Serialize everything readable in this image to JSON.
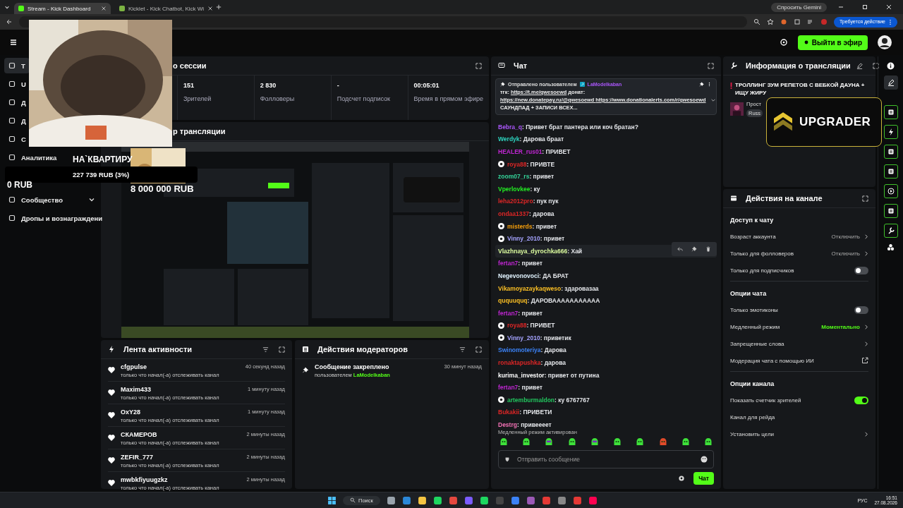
{
  "browser": {
    "tabs": [
      {
        "title": "Stream - Kick Dashboard",
        "selected": true
      },
      {
        "title": "Kicklet - Kick Chatbot, Kick Wi",
        "selected": false
      }
    ],
    "gemini": "Спросить Gemini",
    "action_badge": "Требуется действие"
  },
  "header": {
    "go_live": "Выйти в эфир"
  },
  "sidebar": {
    "items": [
      {
        "label": "Т",
        "selected": true
      },
      {
        "label": "U",
        "selected": false
      },
      {
        "label": "Д",
        "selected": false
      },
      {
        "label": "Д",
        "selected": false
      },
      {
        "label": "С",
        "selected": false
      },
      {
        "label": "Аналитика",
        "selected": false
      },
      {
        "label": "Сообщество",
        "selected": false,
        "expanded": false
      },
      {
        "label": "Дропы и вознаграждени",
        "selected": false
      }
    ]
  },
  "overlay": {
    "goal_title": "НА`КВАРТИРУ",
    "goal_progress": "227 739 RUB (3%)",
    "goal_start": "0 RUB",
    "goal_target": "8 000 000 RUB",
    "badge": "UPGRADER"
  },
  "stats": {
    "title": "о сессии",
    "items": [
      {
        "value": "151",
        "label": "Зрителей"
      },
      {
        "value": "2 830",
        "label": "Фолловеры"
      },
      {
        "value": "-",
        "label": "Подсчет подписок"
      },
      {
        "value": "00:05:01",
        "label": "Время в прямом эфире"
      }
    ]
  },
  "preview": {
    "title": "р трансляции"
  },
  "activity": {
    "title": "Лента активности",
    "events": [
      {
        "user": "cfgpulse",
        "time": "40 секунд назад",
        "text": "только что начал(-а) отслеживать канал"
      },
      {
        "user": "Maxim433",
        "time": "1 минуту назад",
        "text": "только что начал(-а) отслеживать канал"
      },
      {
        "user": "OxY28",
        "time": "1 минуту назад",
        "text": "только что начал(-а) отслеживать канал"
      },
      {
        "user": "СКАМЕРОВ",
        "time": "2 минуты назад",
        "text": "только что начал(-а) отслеживать канал"
      },
      {
        "user": "ZEFIR_777",
        "time": "2 минуты назад",
        "text": "только что начал(-а) отслеживать канал"
      },
      {
        "user": "mwbkfiyuugzkz",
        "time": "2 минуты назад",
        "text": "только что начал(-а) отслеживать канал"
      }
    ]
  },
  "mod_actions": {
    "title": "Действия модераторов",
    "events": [
      {
        "title": "Сообщение закреплено",
        "by": "пользователем",
        "user": "LaModelkaban",
        "time": "30 минут назад"
      }
    ]
  },
  "chat": {
    "title": "Чат",
    "pinned": {
      "label": "Отправлено пользователем",
      "user": "LaModelkaban",
      "parts": [
        {
          "text": "тгк: ",
          "link": false
        },
        {
          "text": "https://t.me/qwesoewd",
          "link": true
        },
        {
          "text": " донат: ",
          "link": false
        },
        {
          "text": "https://new.donatepay.ru/@qwesoewd ",
          "link": true
        },
        {
          "text": "https://www.donationalerts.com/r/qwesoewd",
          "link": true
        },
        {
          "text": " САУНДПАД + ЗАПИСИ ВСЕХ...",
          "link": false
        }
      ]
    },
    "messages": [
      {
        "user": "Bebra_q",
        "color": "#a855f7",
        "text": ": Привет брат пантера или коч братан?",
        "badge": false,
        "hovered": false
      },
      {
        "user": "Werdyk",
        "color": "#2dd4bf",
        "text": ": Дарова браат",
        "badge": false,
        "hovered": false
      },
      {
        "user": "HEALER_rus01",
        "color": "#c026d3",
        "text": ": ПРИВЕТ",
        "badge": false,
        "hovered": false
      },
      {
        "user": "roya88",
        "color": "#dc2626",
        "text": ": ПРИВТЕ",
        "badge": true,
        "hovered": false
      },
      {
        "user": "zoom07_rs",
        "color": "#34d399",
        "text": ": привет",
        "badge": false,
        "hovered": false
      },
      {
        "user": "Vperlovkee",
        "color": "#22ee22",
        "text": ": ку",
        "badge": false,
        "hovered": false
      },
      {
        "user": "leha2012pro",
        "color": "#dc2626",
        "text": ": пук пук",
        "badge": false,
        "hovered": false
      },
      {
        "user": "ondaa1337",
        "color": "#dc2626",
        "text": ": дарова",
        "badge": false,
        "hovered": false
      },
      {
        "user": "misterds",
        "color": "#f59e0b",
        "text": ": привет",
        "badge": true,
        "hovered": false
      },
      {
        "user": "Vinny_2010",
        "color": "#a5a3ff",
        "text": ": привет",
        "badge": true,
        "hovered": false
      },
      {
        "user": "Vlazhnaya_dyrochka666",
        "color": "#d9f99d",
        "text": ": Хай",
        "badge": false,
        "hovered": true
      },
      {
        "user": "fertan7",
        "color": "#c026d3",
        "text": ": привет",
        "badge": false,
        "hovered": false
      },
      {
        "user": "Negevonovoci",
        "color": "#e0f2fe",
        "text": ": ДА БРАТ",
        "badge": false,
        "hovered": false
      },
      {
        "user": "Vikamoyazaykaqweso",
        "color": "#fbbf24",
        "text": ": здаровазаа",
        "badge": false,
        "hovered": false
      },
      {
        "user": "ququuquq",
        "color": "#fbbf24",
        "text": ": ДАРОВААААААААААА",
        "badge": false,
        "hovered": false
      },
      {
        "user": "fertan7",
        "color": "#c026d3",
        "text": ": привет",
        "badge": false,
        "hovered": false
      },
      {
        "user": "roya88",
        "color": "#dc2626",
        "text": ": ПРИВЕТ",
        "badge": true,
        "hovered": false
      },
      {
        "user": "Vinny_2010",
        "color": "#a5a3ff",
        "text": ": приветик",
        "badge": true,
        "hovered": false
      },
      {
        "user": "Swinomoteriya",
        "color": "#3b82f6",
        "text": ": Дарова",
        "badge": false,
        "hovered": false
      },
      {
        "user": "ronaktapushka",
        "color": "#dc2626",
        "text": ": дарова",
        "badge": false,
        "hovered": false
      },
      {
        "user": "kurima_investor",
        "color": "#ffffff",
        "text": ": привет от путина",
        "badge": false,
        "hovered": false
      },
      {
        "user": "fertan7",
        "color": "#c026d3",
        "text": ": привет",
        "badge": false,
        "hovered": false
      },
      {
        "user": "artemburmaldon",
        "color": "#22c55e",
        "text": ": ку 6767767",
        "badge": true,
        "hovered": false
      },
      {
        "user": "Bukakii",
        "color": "#dc2626",
        "text": ": ПРИВЕТИ",
        "badge": false,
        "hovered": false
      },
      {
        "user": "Destrg",
        "color": "#f472b6",
        "text": ": привеееет",
        "badge": false,
        "hovered": false
      }
    ],
    "notice": "Медленный режим активирован",
    "placeholder": "Отправить сообщение",
    "send": "Чат"
  },
  "stream_info": {
    "title": "Информация о трансляции",
    "stream_title": "ТРОЛЛИНГ ЗУМ РЕПЕТОВ С ВЕБКОЙ ДАУНА + ИЩУ ЖИРУ",
    "category": "Прост",
    "tag": "Russ"
  },
  "channel_actions": {
    "title": "Действия на канале",
    "sections": [
      {
        "title": "Доступ к чату",
        "rows": [
          {
            "kind": "select",
            "label": "Возраст аккаунта",
            "value": "Отключить",
            "active": false
          },
          {
            "kind": "select",
            "label": "Только для фолловеров",
            "value": "Отключить",
            "active": false
          },
          {
            "kind": "toggle",
            "label": "Только для подписчиков",
            "on": false
          }
        ]
      },
      {
        "title": "Опции чата",
        "rows": [
          {
            "kind": "toggle",
            "label": "Только эмотиконы",
            "on": false
          },
          {
            "kind": "select",
            "label": "Медленный режим",
            "value": "Моментально",
            "active": true
          },
          {
            "kind": "link",
            "label": "Запрещенные слова"
          },
          {
            "kind": "external",
            "label": "Модерация чата с помощью ИИ"
          }
        ]
      },
      {
        "title": "Опции канала",
        "rows": [
          {
            "kind": "toggle",
            "label": "Показать счетчик зрителей",
            "on": true
          },
          {
            "kind": "plain",
            "label": "Канал для рейда"
          },
          {
            "kind": "link",
            "label": "Установить цели"
          }
        ]
      }
    ]
  },
  "taskbar": {
    "search": "Поиск",
    "lang": "РУС",
    "time": "16:51",
    "date": "27.08.2026"
  }
}
